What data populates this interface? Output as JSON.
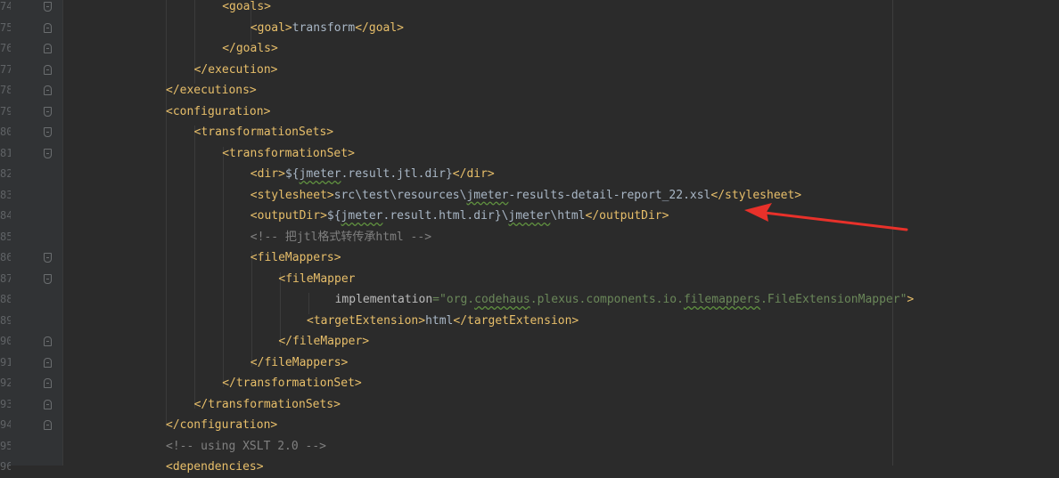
{
  "editor": {
    "line_numbers": [
      "74",
      "75",
      "76",
      "77",
      "78",
      "79",
      "80",
      "81",
      "82",
      "83",
      "84",
      "85",
      "86",
      "87",
      "88",
      "89",
      "90",
      "91",
      "92",
      "93",
      "94",
      "95",
      "96"
    ],
    "lines": [
      {
        "indent": "            ",
        "parts": [
          {
            "c": "tag",
            "t": "<goals>"
          }
        ]
      },
      {
        "indent": "                ",
        "parts": [
          {
            "c": "tag",
            "t": "<goal>"
          },
          {
            "c": "txt",
            "t": "transform"
          },
          {
            "c": "tag",
            "t": "</goal>"
          }
        ]
      },
      {
        "indent": "            ",
        "parts": [
          {
            "c": "tag",
            "t": "</goals>"
          }
        ]
      },
      {
        "indent": "        ",
        "parts": [
          {
            "c": "tag",
            "t": "</execution>"
          }
        ]
      },
      {
        "indent": "    ",
        "parts": [
          {
            "c": "tag",
            "t": "</executions>"
          }
        ]
      },
      {
        "indent": "    ",
        "parts": [
          {
            "c": "tag",
            "t": "<configuration>"
          }
        ]
      },
      {
        "indent": "        ",
        "parts": [
          {
            "c": "tag",
            "t": "<transformationSets>"
          }
        ]
      },
      {
        "indent": "            ",
        "parts": [
          {
            "c": "tag",
            "t": "<transformationSet>"
          }
        ]
      },
      {
        "indent": "                ",
        "parts": [
          {
            "c": "tag",
            "t": "<dir>"
          },
          {
            "c": "txt",
            "t": "${"
          },
          {
            "c": "txt typo",
            "t": "jmeter"
          },
          {
            "c": "txt",
            "t": ".result.jtl.dir}"
          },
          {
            "c": "tag",
            "t": "</dir>"
          }
        ]
      },
      {
        "indent": "                ",
        "parts": [
          {
            "c": "tag",
            "t": "<stylesheet>"
          },
          {
            "c": "txt",
            "t": "src\\test\\resources\\"
          },
          {
            "c": "txt typo",
            "t": "jmeter"
          },
          {
            "c": "txt",
            "t": "-results-detail-report_22.xsl"
          },
          {
            "c": "tag",
            "t": "</stylesheet>"
          }
        ]
      },
      {
        "indent": "                ",
        "parts": [
          {
            "c": "tag",
            "t": "<outputDir>"
          },
          {
            "c": "txt",
            "t": "${"
          },
          {
            "c": "txt typo",
            "t": "jmeter"
          },
          {
            "c": "txt",
            "t": ".result.html.dir}\\"
          },
          {
            "c": "txt typo",
            "t": "jmeter"
          },
          {
            "c": "txt",
            "t": "\\html"
          },
          {
            "c": "tag",
            "t": "</outputDir>"
          }
        ]
      },
      {
        "indent": "                ",
        "parts": [
          {
            "c": "cmt",
            "t": "<!-- 把jtl格式转传承html -->"
          }
        ]
      },
      {
        "indent": "                ",
        "parts": [
          {
            "c": "tag",
            "t": "<fileMappers>"
          }
        ]
      },
      {
        "indent": "                    ",
        "parts": [
          {
            "c": "tag",
            "t": "<fileMapper"
          }
        ]
      },
      {
        "indent": "                            ",
        "parts": [
          {
            "c": "attr",
            "t": "implementation"
          },
          {
            "c": "val",
            "t": "=\"org."
          },
          {
            "c": "val typo",
            "t": "codehaus"
          },
          {
            "c": "val",
            "t": ".plexus.components.io."
          },
          {
            "c": "val typo",
            "t": "filemappers"
          },
          {
            "c": "val",
            "t": ".FileExtensionMapper\""
          },
          {
            "c": "tag",
            "t": ">"
          }
        ]
      },
      {
        "indent": "                        ",
        "parts": [
          {
            "c": "tag",
            "t": "<targetExtension>"
          },
          {
            "c": "txt",
            "t": "html"
          },
          {
            "c": "tag",
            "t": "</targetExtension>"
          }
        ]
      },
      {
        "indent": "                    ",
        "parts": [
          {
            "c": "tag",
            "t": "</fileMapper>"
          }
        ]
      },
      {
        "indent": "                ",
        "parts": [
          {
            "c": "tag",
            "t": "</fileMappers>"
          }
        ]
      },
      {
        "indent": "            ",
        "parts": [
          {
            "c": "tag",
            "t": "</transformationSet>"
          }
        ]
      },
      {
        "indent": "        ",
        "parts": [
          {
            "c": "tag",
            "t": "</transformationSets>"
          }
        ]
      },
      {
        "indent": "    ",
        "parts": [
          {
            "c": "tag",
            "t": "</configuration>"
          }
        ]
      },
      {
        "indent": "    ",
        "parts": [
          {
            "c": "cmt",
            "t": "<!-- using XSLT 2.0 -->"
          }
        ]
      },
      {
        "indent": "    ",
        "parts": [
          {
            "c": "tag",
            "t": "<dependencies>"
          }
        ]
      }
    ],
    "fold_markers": [
      "open",
      "close",
      "close",
      "close",
      "close",
      "open",
      "open",
      "open",
      "",
      "",
      "",
      "",
      "open",
      "open",
      "",
      "",
      "close",
      "close",
      "close",
      "close",
      "close",
      "",
      ""
    ]
  },
  "colors": {
    "background": "#2b2b2b",
    "gutter": "#313335",
    "tag": "#e8bf6a",
    "text": "#a9b7c6",
    "attribute_value": "#6a8759",
    "comment": "#808080",
    "arrow": "#e8312a"
  },
  "annotation": {
    "icon": "red-arrow-icon",
    "points_to_line": "84"
  }
}
